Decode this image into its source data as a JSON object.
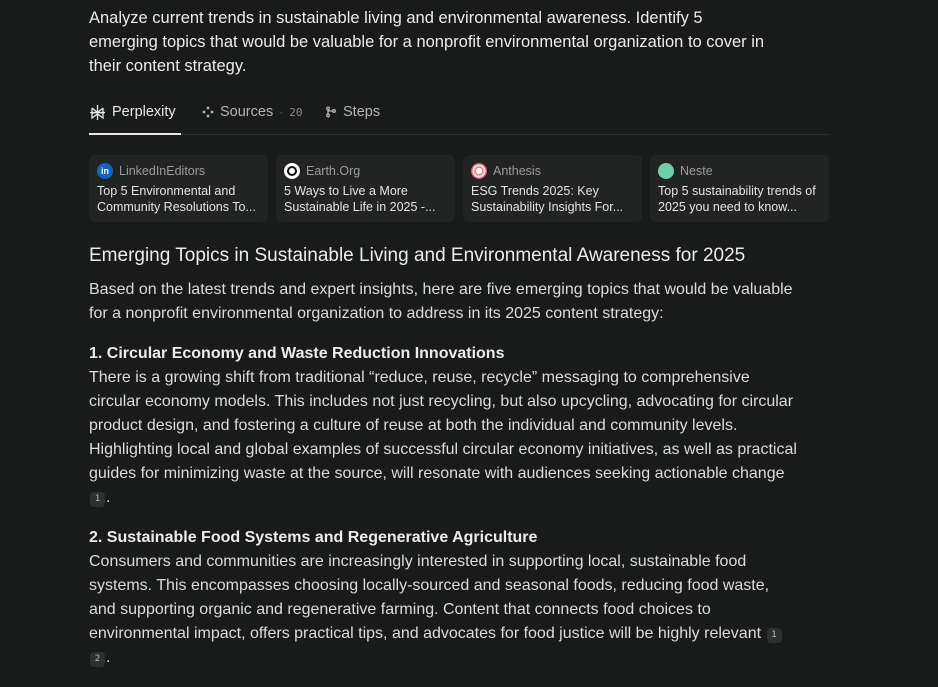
{
  "query": "Analyze current trends in sustainable living and environmental awareness. Identify 5 emerging topics that would be valuable for a nonprofit environmental organization to cover in their content strategy.",
  "tabs": {
    "perplexity": "Perplexity",
    "sources": "Sources",
    "sources_sep": "·",
    "sources_count": "20",
    "steps": "Steps"
  },
  "sources": [
    {
      "site": "LinkedInEditors",
      "title": "Top 5 Environmental and Community Resolutions To...",
      "icon": "linkedin-icon"
    },
    {
      "site": "Earth.Org",
      "title": "5 Ways to Live a More Sustainable Life in 2025 -...",
      "icon": "earth-org-icon"
    },
    {
      "site": "Anthesis",
      "title": "ESG Trends 2025: Key Sustainability Insights For...",
      "icon": "anthesis-icon"
    },
    {
      "site": "Neste",
      "title": "Top 5 sustainability trends of 2025 you need to know...",
      "icon": "neste-icon"
    }
  ],
  "answer": {
    "heading": "Emerging Topics in Sustainable Living and Environmental Awareness for 2025",
    "intro": "Based on the latest trends and expert insights, here are five emerging topics that would be valuable for a nonprofit environmental organization to address in its 2025 content strategy:",
    "sections": [
      {
        "title": "1. Circular Economy and Waste Reduction Innovations",
        "body": "There is a growing shift from traditional “reduce, reuse, recycle” messaging to comprehensive circular economy models. This includes not just recycling, but also upcycling, advocating for circular product design, and fostering a culture of reuse at both the individual and community levels. Highlighting local and global examples of successful circular economy initiatives, as well as practical guides for minimizing waste at the source, will resonate with audiences seeking actionable change",
        "citations": [
          "1"
        ],
        "end": "."
      },
      {
        "title": "2. Sustainable Food Systems and Regenerative Agriculture",
        "body": "Consumers and communities are increasingly interested in supporting local, sustainable food systems. This encompasses choosing locally-sourced and seasonal foods, reducing food waste, and supporting organic and regenerative farming. Content that connects food choices to environmental impact, offers practical tips, and advocates for food justice will be highly relevant",
        "citations": [
          "1",
          "2"
        ],
        "end": "."
      }
    ]
  },
  "colors": {
    "background": "#191a1a",
    "card": "#222323",
    "text": "#e8e8e6",
    "muted": "#9c9d9a",
    "linkedin": "#0a66c2",
    "neste": "#6fd0a3"
  }
}
